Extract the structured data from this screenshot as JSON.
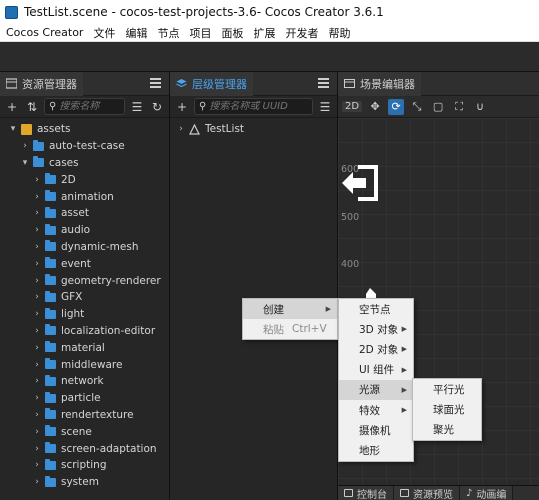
{
  "window": {
    "title": "TestList.scene - cocos-test-projects-3.6- Cocos Creator 3.6.1"
  },
  "menubar": [
    "Cocos Creator",
    "文件",
    "编辑",
    "节点",
    "项目",
    "面板",
    "扩展",
    "开发者",
    "帮助"
  ],
  "assets_panel": {
    "title": "资源管理器",
    "search_placeholder": "搜索名称",
    "tree": [
      {
        "label": "assets",
        "indent": 0,
        "icon": "database-icon",
        "arrow": "▾"
      },
      {
        "label": "auto-test-case",
        "indent": 1,
        "icon": "folder-icon",
        "arrow": "›"
      },
      {
        "label": "cases",
        "indent": 1,
        "icon": "folder-icon",
        "arrow": "▾"
      },
      {
        "label": "2D",
        "indent": 2,
        "icon": "folder-icon",
        "arrow": "›"
      },
      {
        "label": "animation",
        "indent": 2,
        "icon": "folder-icon",
        "arrow": "›"
      },
      {
        "label": "asset",
        "indent": 2,
        "icon": "folder-icon",
        "arrow": "›"
      },
      {
        "label": "audio",
        "indent": 2,
        "icon": "folder-icon",
        "arrow": "›"
      },
      {
        "label": "dynamic-mesh",
        "indent": 2,
        "icon": "folder-icon",
        "arrow": "›"
      },
      {
        "label": "event",
        "indent": 2,
        "icon": "folder-icon",
        "arrow": "›"
      },
      {
        "label": "geometry-renderer",
        "indent": 2,
        "icon": "folder-icon",
        "arrow": "›"
      },
      {
        "label": "GFX",
        "indent": 2,
        "icon": "folder-icon",
        "arrow": "›"
      },
      {
        "label": "light",
        "indent": 2,
        "icon": "folder-icon",
        "arrow": "›"
      },
      {
        "label": "localization-editor",
        "indent": 2,
        "icon": "folder-icon",
        "arrow": "›"
      },
      {
        "label": "material",
        "indent": 2,
        "icon": "folder-icon",
        "arrow": "›"
      },
      {
        "label": "middleware",
        "indent": 2,
        "icon": "folder-icon",
        "arrow": "›"
      },
      {
        "label": "network",
        "indent": 2,
        "icon": "folder-icon",
        "arrow": "›"
      },
      {
        "label": "particle",
        "indent": 2,
        "icon": "folder-icon",
        "arrow": "›"
      },
      {
        "label": "rendertexture",
        "indent": 2,
        "icon": "folder-icon",
        "arrow": "›"
      },
      {
        "label": "scene",
        "indent": 2,
        "icon": "folder-icon",
        "arrow": "›"
      },
      {
        "label": "screen-adaptation",
        "indent": 2,
        "icon": "folder-icon",
        "arrow": "›"
      },
      {
        "label": "scripting",
        "indent": 2,
        "icon": "folder-icon",
        "arrow": "›"
      },
      {
        "label": "system",
        "indent": 2,
        "icon": "folder-icon",
        "arrow": "›"
      }
    ]
  },
  "hierarchy_panel": {
    "title": "层级管理器",
    "search_placeholder": "搜索名称或 UUID",
    "root_node": "TestList"
  },
  "scene_panel": {
    "title": "场景编辑器",
    "btn_2d": "2D",
    "axis_labels": [
      "600",
      "500",
      "400"
    ],
    "bottom_tabs": [
      "控制台",
      "资源预览",
      "动画编"
    ]
  },
  "context_menu": {
    "items": [
      {
        "label": "创建",
        "has_submenu": true,
        "highlighted": true
      },
      {
        "label": "粘贴",
        "shortcut": "Ctrl+V",
        "disabled": true
      }
    ]
  },
  "create_submenu": {
    "items": [
      {
        "label": "空节点",
        "has_submenu": false
      },
      {
        "label": "3D 对象",
        "has_submenu": true
      },
      {
        "label": "2D 对象",
        "has_submenu": true
      },
      {
        "label": "UI 组件",
        "has_submenu": true
      },
      {
        "label": "光源",
        "has_submenu": true,
        "highlighted": true
      },
      {
        "label": "特效",
        "has_submenu": true
      },
      {
        "label": "摄像机",
        "has_submenu": false
      },
      {
        "label": "地形",
        "has_submenu": false
      }
    ]
  },
  "light_submenu": {
    "items": [
      {
        "label": "平行光"
      },
      {
        "label": "球面光"
      },
      {
        "label": "聚光"
      }
    ]
  },
  "colors": {
    "accent": "#3b8fd9",
    "panel_bg": "#262626",
    "menu_bg": "#f0f0f0"
  }
}
